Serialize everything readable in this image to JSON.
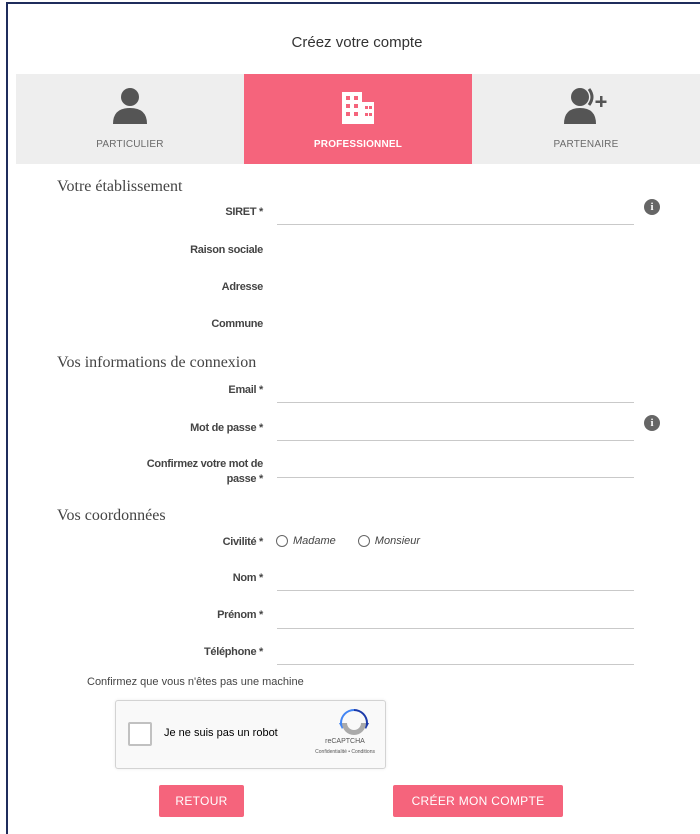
{
  "title": "Créez votre compte",
  "tabs": [
    {
      "label": "PARTICULIER",
      "icon": "person-icon",
      "active": false
    },
    {
      "label": "PROFESSIONNEL",
      "icon": "building-icon",
      "active": true
    },
    {
      "label": "PARTENAIRE",
      "icon": "add-user-icon",
      "active": false
    }
  ],
  "accent_color": "#f5647c",
  "sections": {
    "etablissement": {
      "heading": "Votre établissement",
      "siret": "SIRET *",
      "raison_sociale": "Raison sociale",
      "adresse": "Adresse",
      "commune": "Commune"
    },
    "connexion": {
      "heading": "Vos informations de connexion",
      "email": "Email *",
      "password": "Mot de passe *",
      "confirm_1": "Confirmez votre mot de",
      "confirm_2": "passe *"
    },
    "coordonnees": {
      "heading": "Vos coordonnées",
      "civilite": "Civilité *",
      "madame": "Madame",
      "monsieur": "Monsieur",
      "nom": "Nom *",
      "prenom": "Prénom *",
      "telephone": "Téléphone *"
    }
  },
  "captcha": {
    "note": "Confirmez que vous n'êtes pas une machine",
    "label": "Je ne suis pas un robot",
    "brand": "reCAPTCHA",
    "links": "Confidentialité • Conditions"
  },
  "buttons": {
    "back": "RETOUR",
    "create": "CRÉER MON COMPTE"
  }
}
